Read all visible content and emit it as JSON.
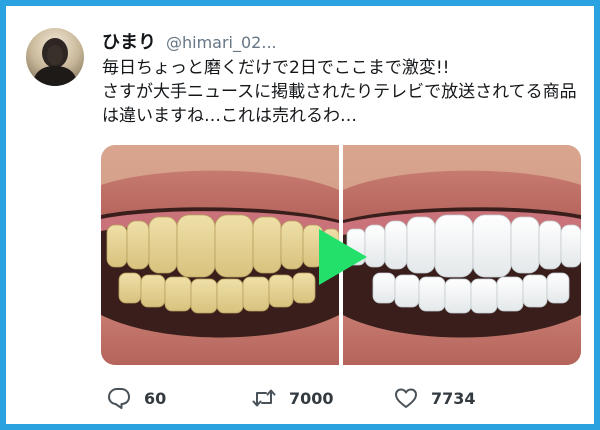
{
  "tweet": {
    "display_name": "ひまり",
    "handle": "@himari_02...",
    "text": "毎日ちょっと磨くだけで2日でここまで激変!!\nさすが大手ニュースに掲載されたりテレビで放送されてる商品は違いますね…これは売れるわ…",
    "media": {
      "subject": "before-after teeth whitening comparison",
      "divider_icon": "play-arrow-icon",
      "arrow_color": "#22e06a"
    }
  },
  "actions": {
    "reply": {
      "icon": "reply-bubble-icon",
      "count": "60"
    },
    "retweet": {
      "icon": "retweet-icon",
      "count": "7000"
    },
    "like": {
      "icon": "heart-icon",
      "count": "7734"
    }
  },
  "colors": {
    "border": "#2aa2e0",
    "text": "#14171a",
    "muted": "#657786"
  }
}
